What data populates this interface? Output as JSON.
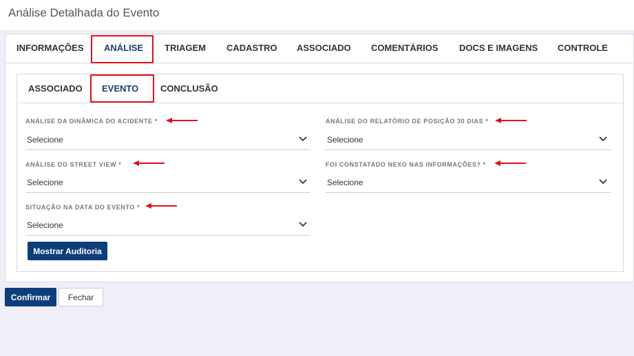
{
  "window": {
    "title": "Análise Detalhada do Evento"
  },
  "main_tabs": [
    {
      "label": "INFORMAÇÕES"
    },
    {
      "label": "ANÁLISE",
      "active": true
    },
    {
      "label": "TRIAGEM"
    },
    {
      "label": "CADASTRO"
    },
    {
      "label": "ASSOCIADO"
    },
    {
      "label": "COMENTÁRIOS"
    },
    {
      "label": "DOCS E IMAGENS"
    },
    {
      "label": "CONTROLE"
    }
  ],
  "sub_tabs": [
    {
      "label": "ASSOCIADO"
    },
    {
      "label": "EVENTO",
      "active": true
    },
    {
      "label": "CONCLUSÃO"
    }
  ],
  "fields": [
    {
      "label": "ANÁLISE DA DINÂMICA DO ACIDENTE",
      "required": "*",
      "value": "Selecione"
    },
    {
      "label": "ANÁLISE DO RELATÓRIO DE POSIÇÃO 30 DIAS",
      "required": "*",
      "value": "Selecione"
    },
    {
      "label": "ANÁLISE DO STREET VIEW",
      "required": "*",
      "value": "Selecione"
    },
    {
      "label": "FOI CONSTATADO NEXO NAS INFORMAÇÕES?",
      "required": "*",
      "value": "Selecione"
    },
    {
      "label": "SITUAÇÃO NA DATA DO EVENTO",
      "required": "*",
      "value": "Selecione"
    }
  ],
  "buttons": {
    "audit": "Mostrar Auditoria",
    "confirm": "Confirmar",
    "close": "Fechar"
  },
  "colors": {
    "primary": "#0e3e7a",
    "highlight": "#e0101a",
    "active_tab": "#1c3f6e"
  },
  "icons": {
    "select": "chevron-down-icon",
    "annotation": "arrow-left-icon"
  }
}
